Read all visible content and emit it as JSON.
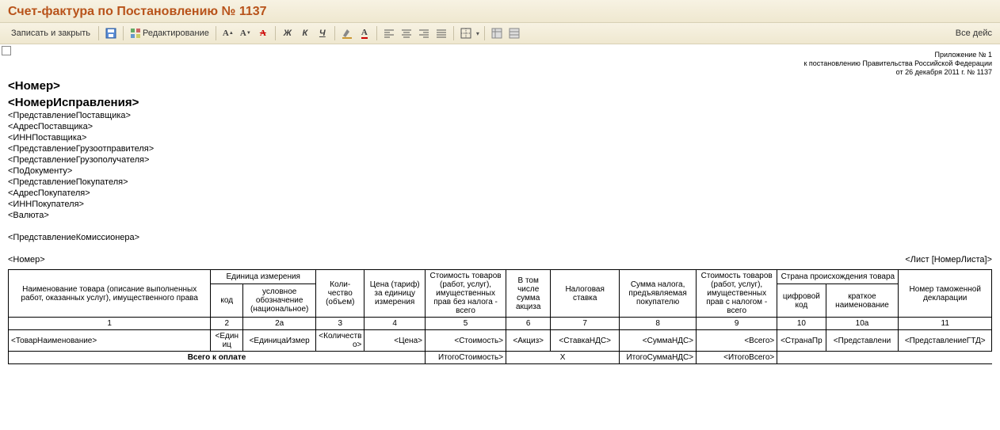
{
  "window": {
    "title": "Счет-фактура по Постановлению № 1137"
  },
  "toolbar": {
    "save_close": "Записать и закрыть",
    "edit": "Редактирование",
    "all_actions": "Все дейс"
  },
  "appendix": {
    "l1": "Приложение № 1",
    "l2": "к постановлению Правительства Российской Федерации",
    "l3": "от 26 декабря 2011 г. № 1137"
  },
  "hdr": {
    "num": "<Номер>",
    "corr": "<НомерИсправления>"
  },
  "fields": [
    "<ПредставлениеПоставщика>",
    "<АдресПоставщика>",
    "<ИННПоставщика>",
    "<ПредставлениеГрузоотправителя>",
    "<ПредставлениеГрузополучателя>",
    "<ПоДокументу>",
    "<ПредставлениеПокупателя>",
    "<АдресПокупателя>",
    "<ИННПокупателя>",
    "<Валюта>"
  ],
  "commissioner": "<ПредставлениеКомиссионера>",
  "sheet": {
    "left": "<Номер>",
    "right": "<Лист [НомерЛиста]>"
  },
  "cols": {
    "c1": "Наименование товара (описание выполненных работ, оказанных услуг), имущественного права",
    "unit_group": "Единица измерения",
    "c2": "код",
    "c2a": "условное обозначение (национальное)",
    "c3": "Коли-чество (объем)",
    "c4": "Цена (тариф) за единицу измерения",
    "c5": "Стоимость товаров (работ, услуг), имущественных прав без налога - всего",
    "c6": "В том числе сумма акциза",
    "c7": "Налоговая ставка",
    "c8": "Сумма налога, предъявляемая покупателю",
    "c9": "Стоимость товаров (работ, услуг), имущественных прав с налогом - всего",
    "country_group": "Страна происхождения товара",
    "c10": "цифровой код",
    "c10a": "краткое наименование",
    "c11": "Номер таможенной декларации"
  },
  "nums": {
    "n1": "1",
    "n2": "2",
    "n2a": "2а",
    "n3": "3",
    "n4": "4",
    "n5": "5",
    "n6": "6",
    "n7": "7",
    "n8": "8",
    "n9": "9",
    "n10": "10",
    "n10a": "10а",
    "n11": "11"
  },
  "row": {
    "c1": "<ТоварНаименование>",
    "c2": "<Единиц",
    "c2a": "<ЕдиницаИзмер",
    "c3": "<Количество>",
    "c4": "<Цена>",
    "c5": "<Стоимость>",
    "c6": "<Акциз>",
    "c7": "<СтавкаНДС>",
    "c8": "<СуммаНДС>",
    "c9": "<Всего>",
    "c10": "<СтранаПр",
    "c10a": "<Представлени",
    "c11": "<ПредставлениеГТД>"
  },
  "total": {
    "label": "Всего к оплате",
    "c5": "ИтогоСтоимость>",
    "c6": "X",
    "c8": "ИтогоСуммаНДС>",
    "c9": "<ИтогоВсего>"
  }
}
